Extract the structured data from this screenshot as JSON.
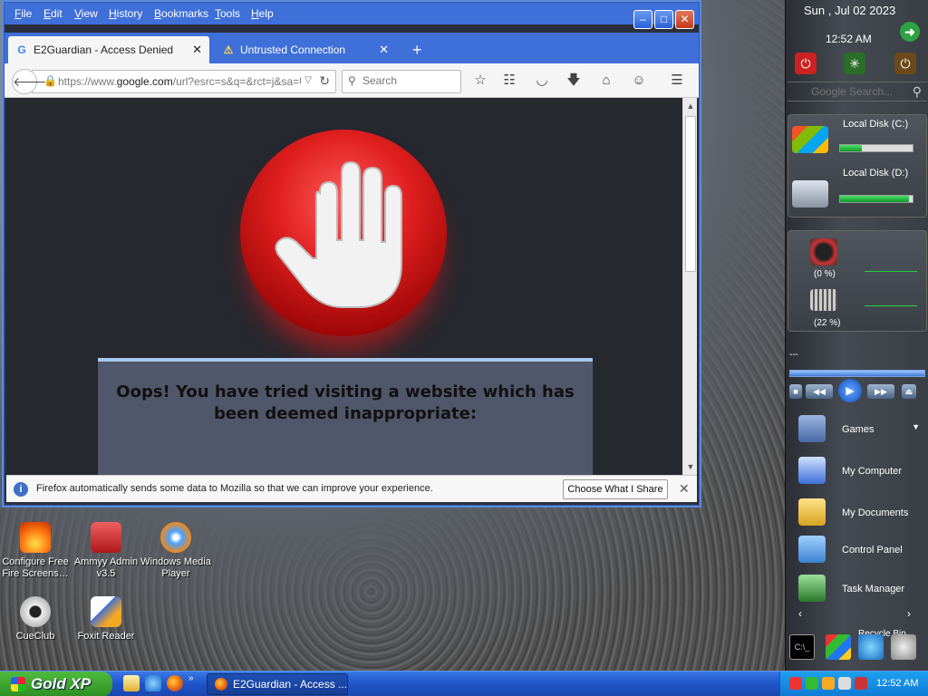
{
  "browser": {
    "menu": [
      "File",
      "Edit",
      "View",
      "History",
      "Bookmarks",
      "Tools",
      "Help"
    ],
    "tabs": [
      {
        "label": "E2Guardian - Access Denied",
        "icon": "G",
        "active": true
      },
      {
        "label": "Untrusted Connection",
        "icon": "⚠",
        "active": false
      }
    ],
    "url": {
      "prefix": "https://www.",
      "host": "google.com",
      "rest": "/url?esrc=s&q=&rct=j&sa=U&"
    },
    "search_placeholder": "Search",
    "page": {
      "message": "Oops! You have tried visiting a website which has been deemed inappropriate:"
    },
    "notification": {
      "text": "Firefox automatically sends some data to Mozilla so that we can improve your experience.",
      "button": "Choose What I Share"
    }
  },
  "desktop_icons": [
    {
      "label": "Configure Free Fire Screens…",
      "icon": "flame-icon"
    },
    {
      "label": "Ammyy Admin v3.5",
      "icon": "ammyy-icon"
    },
    {
      "label": "Windows Media Player",
      "icon": "media-player-icon"
    },
    {
      "label": "CueClub",
      "icon": "cueclub-icon"
    },
    {
      "label": "Foxit Reader",
      "icon": "foxit-icon"
    }
  ],
  "sidebar": {
    "date": "Sun , Jul 02 2023",
    "time": "12:52 AM",
    "search_placeholder": "Google Search...",
    "disks": [
      {
        "label": "Local Disk (C:)",
        "used_fraction": 0.3
      },
      {
        "label": "Local Disk (D:)",
        "used_fraction": 0.95
      }
    ],
    "cpu": "(0 %)",
    "memory": "(22 %)",
    "media_separator": "---",
    "launchers": [
      "Games",
      "My Computer",
      "My Documents",
      "Control Panel",
      "Task Manager"
    ],
    "recycle": "Recycle Bin"
  },
  "taskbar": {
    "start": "Gold XP",
    "task_button": "E2Guardian - Access ...",
    "clock": "12:52 AM"
  },
  "colors": {
    "stop_red": "#e01f1f",
    "page_bg": "#25282f",
    "message_box": "#51576a",
    "taskbar_blue": "#1f55c8",
    "start_green": "#2d8f22"
  }
}
